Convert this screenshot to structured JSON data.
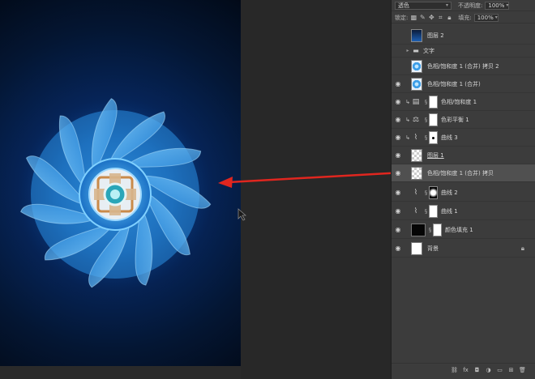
{
  "layers_panel": {
    "blend_mode": "透色",
    "opacity_label": "不透明度:",
    "opacity_value": "100%",
    "lock_label": "锁定:",
    "fill_label": "填充:",
    "fill_value": "100%",
    "layers": [
      {
        "name": "图层 2",
        "thumb": "phone",
        "eye": false
      },
      {
        "name": "文字",
        "type": "group",
        "eye": false
      },
      {
        "name": "色相/饱和度 1 (合并) 拷贝 2",
        "thumb": "fan",
        "eye": false
      },
      {
        "name": "色相/饱和度 1 (合并)",
        "thumb": "fan",
        "eye": true
      },
      {
        "name": "色相/饱和度 1",
        "type": "adjustment",
        "eye": true
      },
      {
        "name": "色彩平衡 1",
        "type": "adjustment",
        "eye": true
      },
      {
        "name": "曲线 3",
        "type": "adjustment",
        "eye": true
      },
      {
        "name": "图层 1",
        "thumb": "checker",
        "eye": true
      },
      {
        "name": "色相/饱和度 1 (合并) 拷贝",
        "thumb": "checker",
        "eye": true,
        "selected": true
      },
      {
        "name": "曲线 2",
        "type": "adjustment",
        "eye": true
      },
      {
        "name": "曲线 1",
        "type": "adjustment",
        "eye": true
      },
      {
        "name": "颜色填充 1",
        "type": "fill",
        "eye": true
      },
      {
        "name": "背景",
        "thumb": "white",
        "eye": true,
        "locked": true
      }
    ],
    "footer_icons": [
      "link-icon",
      "fx-icon",
      "mask-icon",
      "adjustment-icon",
      "group-icon",
      "new-layer-icon",
      "trash-icon"
    ]
  },
  "colors": {
    "panel_bg": "#3c3c3c",
    "selected_row": "#505050",
    "arrow": "#e0261f",
    "fan_blue": "#2b8fe0"
  }
}
